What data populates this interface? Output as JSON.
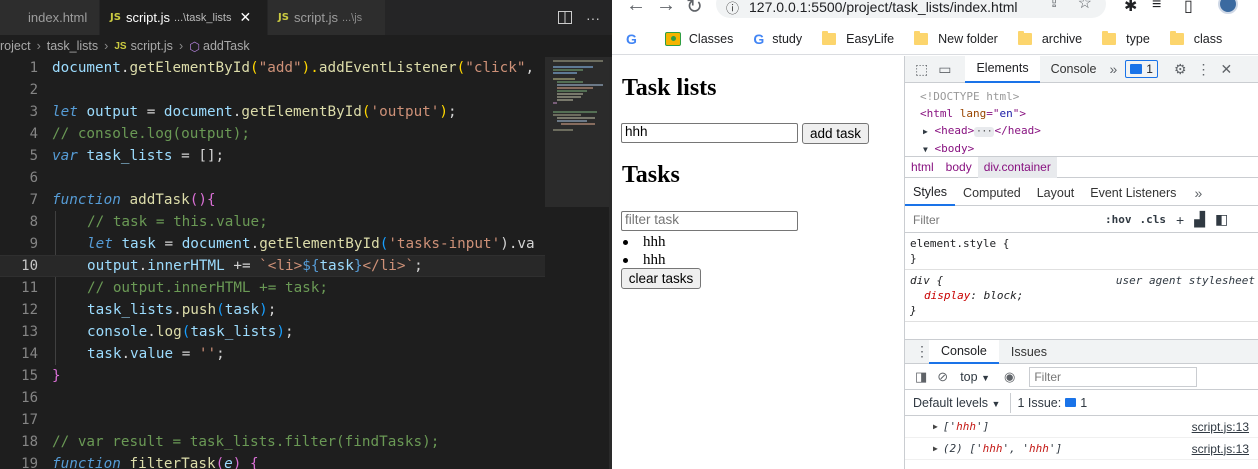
{
  "vscode": {
    "tabs": [
      {
        "name": "index.html",
        "desc": "",
        "active": false
      },
      {
        "name": "script.js",
        "desc": "...\\task_lists",
        "active": true
      },
      {
        "name": "script.js",
        "desc": "...\\js",
        "active": false
      }
    ],
    "js_badge": "JS",
    "close_glyph": "✕",
    "breadcrumb": {
      "part1": "roject",
      "part2": "task_lists",
      "part3": "script.js",
      "part4": "addTask"
    },
    "line_numbers": [
      "1",
      "2",
      "3",
      "4",
      "5",
      "6",
      "7",
      "8",
      "9",
      "10",
      "11",
      "12",
      "13",
      "14",
      "15",
      "16",
      "17",
      "18",
      "19"
    ],
    "current_line": "10",
    "code": {
      "l1_a": "document",
      "l1_b": ".",
      "l1_c": "getElementById",
      "l1_d": "(",
      "l1_e": "\"add\"",
      "l1_f": ").",
      "l1_g": "addEventListener",
      "l1_h": "(",
      "l1_i": "\"click\"",
      "l1_j": ",",
      "l3_kw": "let",
      "l3_var": "output",
      "l3_eq": " = ",
      "l3_doc": "document",
      "l3_dot": ".",
      "l3_fn": "getElementById",
      "l3_p1": "(",
      "l3_str": "'output'",
      "l3_p2": ")",
      "l3_end": ";",
      "l4": "// console.log(output);",
      "l5_kw": "var",
      "l5_var": "task_lists",
      "l5_rest": " = [];",
      "l7_kw": "function",
      "l7_fn": "addTask",
      "l7_paren": "()",
      "l7_brace": "{",
      "l8": "// task = this.value;",
      "l9_kw": "let",
      "l9_var": "task",
      "l9_eq": " = ",
      "l9_doc": "document",
      "l9_dot": ".",
      "l9_fn": "getElementById",
      "l9_p1": "(",
      "l9_str": "'tasks-input'",
      "l9_rest": ").va",
      "l10_var": "output",
      "l10_dot": ".",
      "l10_prop": "innerHTML",
      "l10_op": " += ",
      "l10_t1": "`<li>",
      "l10_t2": "${",
      "l10_t3": "task",
      "l10_t4": "}",
      "l10_t5": "</li>`",
      "l10_end": ";",
      "l11": "// output.innerHTML += task;",
      "l12_var": "task_lists",
      "l12_dot": ".",
      "l12_fn": "push",
      "l12_p1": "(",
      "l12_arg": "task",
      "l12_p2": ")",
      "l12_end": ";",
      "l13_var": "console",
      "l13_dot": ".",
      "l13_fn": "log",
      "l13_p1": "(",
      "l13_arg": "task_lists",
      "l13_p2": ")",
      "l13_end": ";",
      "l14_var": "task",
      "l14_dot": ".",
      "l14_prop": "value",
      "l14_eq": " = ",
      "l14_str": "''",
      "l14_end": ";",
      "l15": "}",
      "l18": "// var result = task_lists.filter(findTasks);",
      "l19_kw": "function",
      "l19_fn": "filterTask",
      "l19_p1": "(",
      "l19_arg": "e",
      "l19_p2": ")",
      "l19_brace": " {"
    }
  },
  "browser": {
    "url": "127.0.0.1:5500/project/task_lists/index.html",
    "bookmarks": [
      "Classes",
      "study",
      "EasyLife",
      "New folder",
      "archive",
      "type",
      "class"
    ],
    "page": {
      "heading1": "Task lists",
      "tasks_input_value": "hhh",
      "add_button": "add task",
      "heading2": "Tasks",
      "filter_placeholder": "filter task",
      "items": [
        "hhh",
        "hhh"
      ],
      "clear_button": "clear tasks"
    }
  },
  "devtools": {
    "tabs": [
      "Elements",
      "Console"
    ],
    "issues_count": "1",
    "dom": {
      "doctype": "<!DOCTYPE html>",
      "html_open": "<html ",
      "lang_attr": "lang",
      "lang_eq": "=\"",
      "lang_val": "en",
      "lang_close": "\">",
      "head_open": "<head>",
      "head_close": "</head>",
      "ellipsis": "···",
      "body": "<body>"
    },
    "crumbs": [
      "html",
      "body",
      "div.container"
    ],
    "style_tabs": [
      "Styles",
      "Computed",
      "Layout",
      "Event Listeners"
    ],
    "filter_placeholder": "Filter",
    "hov": ":hov",
    "cls": ".cls",
    "rules": {
      "r1_sel": "element.style {",
      "r1_close": "}",
      "r2_sel": "div {",
      "r2_src": "user agent stylesheet",
      "r2_prop": "display",
      "r2_val": "block;",
      "r2_close": "}"
    },
    "drawer_tabs": [
      "Console",
      "Issues"
    ],
    "context": "top",
    "console_filter": "Filter",
    "default_levels": "Default levels",
    "issue_chip": "1 Issue:",
    "issue_chip_count": "1",
    "logs": [
      {
        "prefix": "",
        "open": "['",
        "val1": "hhh",
        "mid": "",
        "val2": "",
        "close": "']",
        "src": "script.js:13"
      },
      {
        "prefix": "(2) ",
        "open": "['",
        "val1": "hhh",
        "mid": "', '",
        "val2": "hhh",
        "close": "']",
        "src": "script.js:13"
      }
    ]
  }
}
